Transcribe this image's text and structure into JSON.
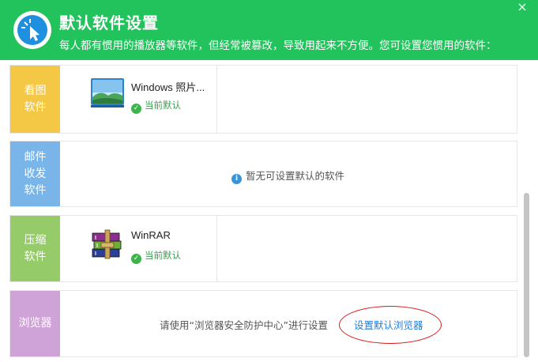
{
  "header": {
    "title": "默认软件设置",
    "subtitle": "每人都有惯用的播放器等软件，但经常被篡改，导致用起来不方便。您可设置您惯用的软件：",
    "close_label": "×"
  },
  "sections": {
    "image": {
      "category": "看图软件",
      "app_name": "Windows 照片...",
      "status": "当前默认"
    },
    "mail": {
      "category": "邮件收发软件",
      "notice": "暂无可设置默认的软件"
    },
    "zip": {
      "category": "压缩软件",
      "app_name": "WinRAR",
      "status": "当前默认"
    },
    "browser": {
      "category": "浏览器",
      "text": "请使用“浏览器安全防护中心”进行设置",
      "link": "设置默认浏览器"
    }
  },
  "icons": {
    "logo": "click-cursor-icon",
    "status": "check-circle-icon",
    "info": "info-icon",
    "photos_app": "photo-viewer-icon",
    "winrar_app": "winrar-books-icon"
  },
  "colors": {
    "header": "#22c35c",
    "image_category": "#f4c744",
    "mail_category": "#7ab5ea",
    "zip_category": "#96cb6a",
    "browser_category": "#cfa3d8",
    "link": "#1f7fd8",
    "highlight": "#d81b1b"
  }
}
